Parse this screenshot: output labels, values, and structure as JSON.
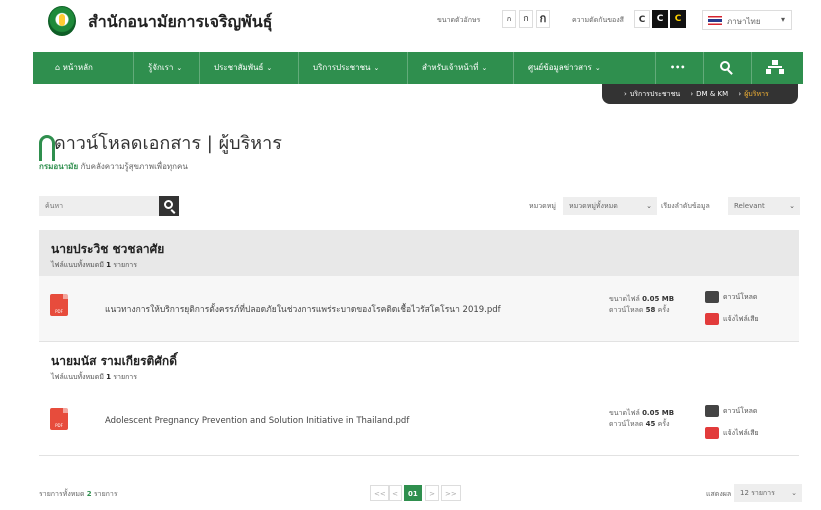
{
  "header": {
    "site_title": "สำนักอนามัยการเจริญพันธุ์",
    "font_size_label": "ขนาดตัวอักษร",
    "font_sizes": [
      "ก",
      "ก",
      "ก"
    ],
    "contrast_label": "ความตัดกันของสี",
    "contrast_options": [
      "C",
      "C",
      "C"
    ],
    "language": "ภาษาไทย"
  },
  "nav": {
    "items": [
      {
        "label": "หน้าหลัก",
        "icon": "home-icon",
        "has_caret": false
      },
      {
        "label": "รู้จักเรา",
        "has_caret": true
      },
      {
        "label": "ประชาสัมพันธ์",
        "has_caret": true
      },
      {
        "label": "บริการประชาชน",
        "has_caret": true
      },
      {
        "label": "สำหรับเจ้าหน้าที่",
        "has_caret": true
      },
      {
        "label": "ศูนย์ข้อมูลข่าวสาร",
        "has_caret": true
      }
    ],
    "more": "•••",
    "search_icon": "search-icon",
    "sitemap_icon": "sitemap-icon"
  },
  "breadcrumb": [
    "บริการประชาชน",
    "DM & KM",
    "ผู้บริหาร"
  ],
  "page": {
    "title": "ดาวน์โหลดเอกสาร | ผู้บริหาร",
    "subtitle_org": "กรมอนามัย",
    "subtitle_rest": " กับคลังความรู้สุขภาพเพื่อทุกคน"
  },
  "search": {
    "placeholder": "ค้นหา"
  },
  "filters": {
    "category_label": "หมวดหมู่",
    "category_value": "หมวดหมู่ทั้งหมด",
    "sort_label": "เรียงลำดับข้อมูล",
    "sort_value": "Relevant"
  },
  "groups": [
    {
      "name": "นายประวิช ชวชลาศัย",
      "count_label": "ไฟล์แนบทั้งหมดมี",
      "count": "1",
      "count_unit": "รายการ",
      "files": [
        {
          "name": "แนวทางการให้บริการยุติการตั้งครรภ์ที่ปลอดภัยในช่วงการแพร่ระบาดของโรคติดเชื้อไวรัสโคโรนา 2019.pdf",
          "size_label": "ขนาดไฟล์",
          "size": "0.05 MB",
          "downloads_label": "ดาวน์โหลด",
          "downloads": "58",
          "downloads_unit": "ครั้ง",
          "download_action": "ดาวน์โหลด",
          "report_action": "แจ้งไฟล์เสีย"
        }
      ]
    },
    {
      "name": "นายมนัส รามเกียรติศักดิ์",
      "count_label": "ไฟล์แนบทั้งหมดมี",
      "count": "1",
      "count_unit": "รายการ",
      "files": [
        {
          "name": "Adolescent Pregnancy Prevention and Solution Initiative in Thailand.pdf",
          "size_label": "ขนาดไฟล์",
          "size": "0.05 MB",
          "downloads_label": "ดาวน์โหลด",
          "downloads": "45",
          "downloads_unit": "ครั้ง",
          "download_action": "ดาวน์โหลด",
          "report_action": "แจ้งไฟล์เสีย"
        }
      ]
    }
  ],
  "footer": {
    "total_label": "รายการทั้งหมด",
    "total": "2",
    "total_unit": "รายการ",
    "pagination": {
      "first": "<<",
      "prev": "<",
      "current": "01",
      "next": ">",
      "last": ">>"
    },
    "per_page_label": "แสดงผล",
    "per_page_value": "12 รายการ"
  },
  "colors": {
    "brand_green": "#2f8f4e",
    "accent_orange": "#f2b134",
    "pdf_red": "#e74c3c",
    "download_dark": "#444444",
    "report_red": "#e23b3b"
  }
}
